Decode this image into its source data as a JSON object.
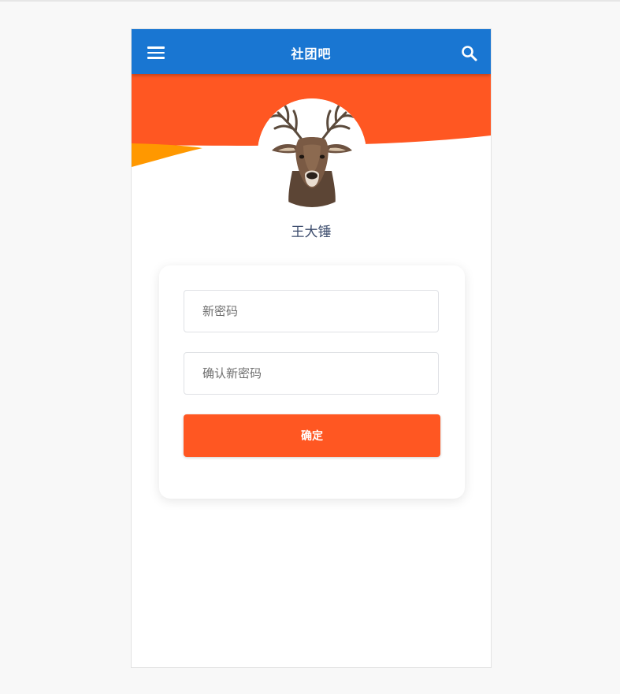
{
  "app": {
    "title": "社团吧"
  },
  "header": {
    "menu_icon": "menu-icon",
    "search_icon": "search-icon"
  },
  "profile": {
    "name": "王大锤",
    "avatar": "deer-avatar"
  },
  "form": {
    "new_password": {
      "placeholder": "新密码",
      "value": ""
    },
    "confirm_password": {
      "placeholder": "确认新密码",
      "value": ""
    },
    "submit_label": "确定"
  },
  "colors": {
    "appbar": "#1976d2",
    "banner_primary": "#ff5722",
    "banner_accent": "#ff9800",
    "button": "#ff5722",
    "username_text": "#3a4a6b"
  }
}
